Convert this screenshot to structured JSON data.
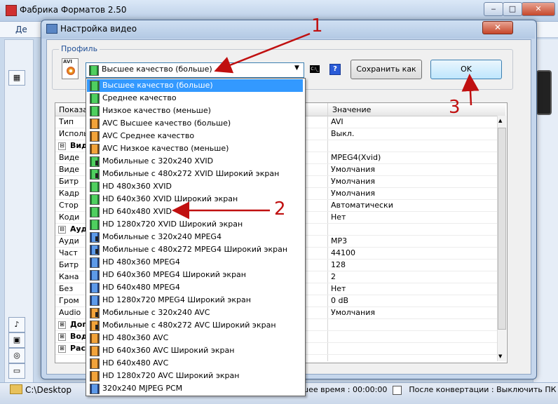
{
  "main_window": {
    "title": "Фабрика Форматов 2.50",
    "menu_first": "Де",
    "min_label": "‒",
    "max_label": "□",
    "close_label": "✕",
    "status_path": "C:\\Desktop",
    "status_time": "шее время : 00:00:00",
    "status_after": "После конвертации : Выключить ПК"
  },
  "dialog": {
    "title": "Настройка видео",
    "close_label": "✕",
    "profile_label": "Профиль",
    "avi_label": "AVI",
    "selected_profile": "Высшее качество (больше)",
    "dropdown_arrow": "▼",
    "cmd_label": "C:\\_",
    "help_label": "?",
    "save_as_label": "Сохранить как",
    "ok_label": "OK"
  },
  "grid": {
    "header_col1": "Показат",
    "header_col2": "Значение",
    "rows": [
      {
        "name": "Тип",
        "value": "AVI"
      },
      {
        "name": "Исполь",
        "value": "Выкл."
      },
      {
        "name": "Вид",
        "value": "",
        "section": true,
        "toggle": "⊟"
      },
      {
        "name": "Виде",
        "value": "MPEG4(Xvid)"
      },
      {
        "name": "Виде",
        "value": "Умолчания"
      },
      {
        "name": "Битр",
        "value": "Умолчания"
      },
      {
        "name": "Кадр",
        "value": "Умолчания"
      },
      {
        "name": "Стор",
        "value": "Автоматически"
      },
      {
        "name": "Коди",
        "value": "Нет"
      },
      {
        "name": "Ауд",
        "value": "",
        "section": true,
        "toggle": "⊟"
      },
      {
        "name": "Ауди",
        "value": "MP3"
      },
      {
        "name": "Част",
        "value": "44100"
      },
      {
        "name": "Битр",
        "value": "128"
      },
      {
        "name": "Кана",
        "value": "2"
      },
      {
        "name": "Без",
        "value": "Нет"
      },
      {
        "name": "Гром",
        "value": "0 dB"
      },
      {
        "name": "Audio",
        "value": "Умолчания"
      },
      {
        "name": "Доп",
        "value": "",
        "section": true,
        "toggle": "⊞"
      },
      {
        "name": "Вод",
        "value": "",
        "section": true,
        "toggle": "⊞"
      },
      {
        "name": "Рас",
        "value": "",
        "section": true,
        "toggle": "⊞"
      }
    ]
  },
  "dropdown": {
    "items": [
      {
        "label": "Высшее качество (больше)",
        "icon": "green"
      },
      {
        "label": "Среднее качество",
        "icon": "green"
      },
      {
        "label": "Низкое качество (меньше)",
        "icon": "green"
      },
      {
        "label": "AVC Высшее качество (больше)",
        "icon": "orange"
      },
      {
        "label": "AVC Среднее качество",
        "icon": "orange"
      },
      {
        "label": "AVC Низкое качество (меньше)",
        "icon": "orange"
      },
      {
        "label": "Мобильные с 320x240 XVID",
        "icon": "green-phone"
      },
      {
        "label": "Мобильные с 480x272 XVID Широкий экран",
        "icon": "green-phone"
      },
      {
        "label": "HD 480x360 XVID",
        "icon": "green"
      },
      {
        "label": "HD 640x360 XVID Широкий экран",
        "icon": "green"
      },
      {
        "label": "HD 640x480 XVID",
        "icon": "green"
      },
      {
        "label": "HD 1280x720 XVID Широкий экран",
        "icon": "green"
      },
      {
        "label": "Мобильные с 320x240 MPEG4",
        "icon": "blue-phone"
      },
      {
        "label": "Мобильные с 480x272 MPEG4 Широкий экран",
        "icon": "blue-phone"
      },
      {
        "label": "HD 480x360 MPEG4",
        "icon": "blue"
      },
      {
        "label": "HD 640x360 MPEG4 Широкий экран",
        "icon": "blue"
      },
      {
        "label": "HD 640x480 MPEG4",
        "icon": "blue"
      },
      {
        "label": "HD 1280x720 MPEG4 Широкий экран",
        "icon": "blue"
      },
      {
        "label": "Мобильные с 320x240 AVC",
        "icon": "orange-phone"
      },
      {
        "label": "Мобильные с 480x272 AVC Широкий экран",
        "icon": "orange-phone"
      },
      {
        "label": "HD 480x360 AVC",
        "icon": "orange"
      },
      {
        "label": "HD 640x360 AVC Широкий экран",
        "icon": "orange"
      },
      {
        "label": "HD 640x480 AVC",
        "icon": "orange"
      },
      {
        "label": "HD 1280x720 AVC Широкий экран",
        "icon": "orange"
      },
      {
        "label": "320x240 MJPEG PCM",
        "icon": "blue"
      }
    ]
  },
  "annotations": {
    "n1": "1",
    "n2": "2",
    "n3": "3",
    "color": "#c01010"
  },
  "colors": {
    "selection": "#3399ff",
    "title_accent": "#1f4e96"
  }
}
